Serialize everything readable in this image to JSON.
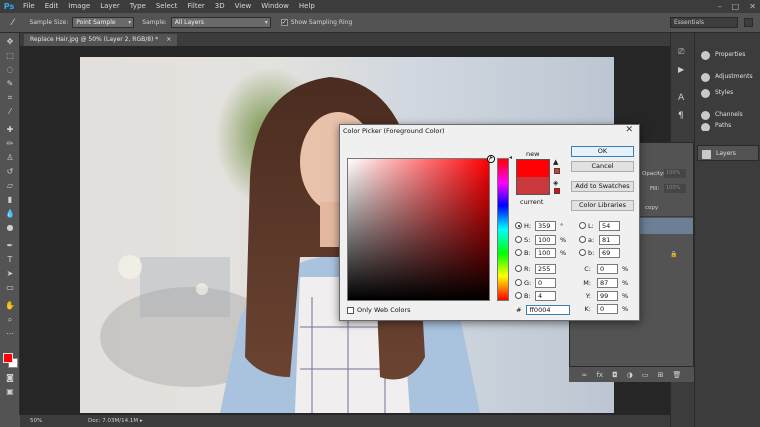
{
  "app": {
    "logo": "Ps",
    "menu": [
      "File",
      "Edit",
      "Image",
      "Layer",
      "Type",
      "Select",
      "Filter",
      "3D",
      "View",
      "Window",
      "Help"
    ],
    "window_controls": [
      "–",
      "□",
      "✕"
    ]
  },
  "options_bar": {
    "sample_size_label": "Sample Size:",
    "sample_size_value": "Point Sample",
    "sample_label": "Sample:",
    "sample_value": "All Layers",
    "show_ring_label": "Show Sampling Ring",
    "workspace": "Essentials"
  },
  "document": {
    "tab_title": "Replace Hair.jpg @ 50% (Layer 2, RGB/8) *",
    "zoom": "50%",
    "doc_info": "Doc: 7.03M/14.1M"
  },
  "panels": {
    "items": [
      "Properties",
      "Adjustments",
      "Styles",
      "Channels",
      "Paths",
      "Layers"
    ],
    "layers": {
      "opacity_label": "Opacity:",
      "opacity_value": "100%",
      "fill_label": "Fill:",
      "fill_value": "100%",
      "layer_fragment": "copy"
    }
  },
  "color_picker": {
    "title": "Color Picker (Foreground Color)",
    "close": "✕",
    "new_label": "new",
    "current_label": "current",
    "new_color": "#ff0004",
    "current_color": "#c8383c",
    "buttons": {
      "ok": "OK",
      "cancel": "Cancel",
      "add_to_swatches": "Add to Swatches",
      "color_libraries": "Color Libraries"
    },
    "hsb": {
      "h": "359",
      "h_unit": "°",
      "s": "100",
      "s_unit": "%",
      "b": "100",
      "b_unit": "%"
    },
    "rgb": {
      "r": "255",
      "g": "0",
      "b": "4"
    },
    "lab": {
      "l": "54",
      "a": "81",
      "b": "69"
    },
    "cmyk": {
      "c": "0",
      "m": "87",
      "y": "99",
      "k": "0",
      "unit": "%"
    },
    "hex_prefix": "#",
    "hex": "ff0004",
    "only_web_colors": "Only Web Colors",
    "warning_icon": "gamut-warning-icon",
    "cube_icon": "web-safe-cube-icon"
  }
}
